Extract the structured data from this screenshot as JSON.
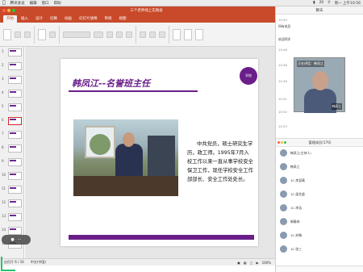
{
  "menubar": {
    "items": [
      "腾讯会议",
      "编辑",
      "窗口",
      "帮助"
    ],
    "battery": "20",
    "clock": "周一 上午10:56"
  },
  "ppt": {
    "window_title": "三个老师线上实践会",
    "tabs": [
      "开始",
      "插入",
      "设计",
      "切换",
      "动画",
      "幻灯片放映",
      "审阅",
      "视图"
    ],
    "active_tab": "开始",
    "slide_numbers": [
      "1",
      "2",
      "3",
      "4",
      "5",
      "6",
      "7",
      "8",
      "9",
      "10",
      "11",
      "12",
      "13",
      "14",
      "15"
    ],
    "status_left": "幻灯片 6 / 16",
    "status_lang": "中文(中国)",
    "zoom": "100%"
  },
  "slide": {
    "title": "韩凤江--名誉班主任",
    "logo_text": "学校",
    "body": "中共党员，硕士研究生学历，政工师。1995年7月入校工作以来一直从事学校安全保卫工作，现任学校安全工作部部长、安全工作处处长。"
  },
  "chat": {
    "title": "聊天",
    "messages": [
      {
        "text": "10:45"
      },
      {
        "text": "所有成员",
        "bold": true
      },
      {
        "text": "欢迎同学",
        "bold": true
      },
      {
        "text": "10:46"
      },
      {
        "text": "10:48"
      },
      {
        "text": "10:49"
      },
      {
        "text": "10:51"
      },
      {
        "text": "10:52"
      },
      {
        "text": "10:53"
      }
    ],
    "video": {
      "top_label": "正在讲话：韩凤江",
      "name": "韩凤江"
    }
  },
  "people": {
    "title": "管理成员(170)",
    "members": [
      {
        "name": "韩凤江(主持人)"
      },
      {
        "name": "韩凤江"
      },
      {
        "name": "1C-李夏晴"
      },
      {
        "name": "1C-梁艺道"
      },
      {
        "name": "1C-李浩"
      },
      {
        "name": "郭春林"
      },
      {
        "name": "1C-刘畅"
      },
      {
        "name": "1C-张三"
      }
    ]
  }
}
